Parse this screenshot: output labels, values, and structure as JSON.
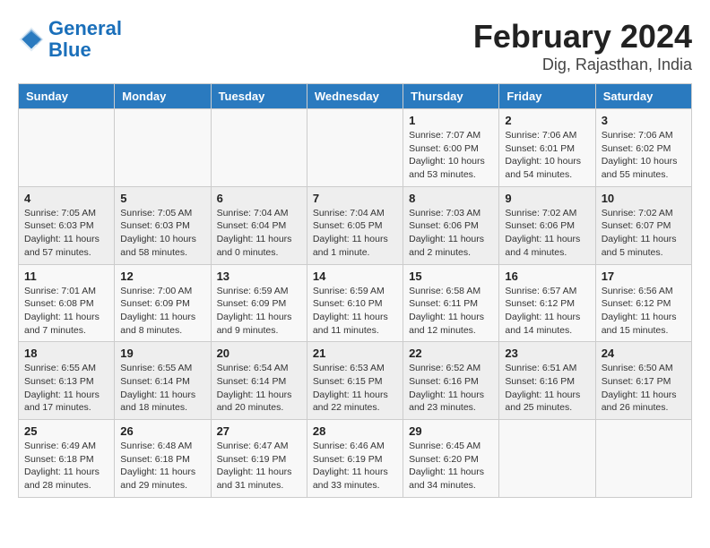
{
  "header": {
    "logo_line1": "General",
    "logo_line2": "Blue",
    "title": "February 2024",
    "subtitle": "Dig, Rajasthan, India"
  },
  "days_of_week": [
    "Sunday",
    "Monday",
    "Tuesday",
    "Wednesday",
    "Thursday",
    "Friday",
    "Saturday"
  ],
  "weeks": [
    [
      {
        "day": "",
        "info": ""
      },
      {
        "day": "",
        "info": ""
      },
      {
        "day": "",
        "info": ""
      },
      {
        "day": "",
        "info": ""
      },
      {
        "day": "1",
        "info": "Sunrise: 7:07 AM\nSunset: 6:00 PM\nDaylight: 10 hours and 53 minutes."
      },
      {
        "day": "2",
        "info": "Sunrise: 7:06 AM\nSunset: 6:01 PM\nDaylight: 10 hours and 54 minutes."
      },
      {
        "day": "3",
        "info": "Sunrise: 7:06 AM\nSunset: 6:02 PM\nDaylight: 10 hours and 55 minutes."
      }
    ],
    [
      {
        "day": "4",
        "info": "Sunrise: 7:05 AM\nSunset: 6:03 PM\nDaylight: 11 hours and 57 minutes."
      },
      {
        "day": "5",
        "info": "Sunrise: 7:05 AM\nSunset: 6:03 PM\nDaylight: 10 hours and 58 minutes."
      },
      {
        "day": "6",
        "info": "Sunrise: 7:04 AM\nSunset: 6:04 PM\nDaylight: 11 hours and 0 minutes."
      },
      {
        "day": "7",
        "info": "Sunrise: 7:04 AM\nSunset: 6:05 PM\nDaylight: 11 hours and 1 minute."
      },
      {
        "day": "8",
        "info": "Sunrise: 7:03 AM\nSunset: 6:06 PM\nDaylight: 11 hours and 2 minutes."
      },
      {
        "day": "9",
        "info": "Sunrise: 7:02 AM\nSunset: 6:06 PM\nDaylight: 11 hours and 4 minutes."
      },
      {
        "day": "10",
        "info": "Sunrise: 7:02 AM\nSunset: 6:07 PM\nDaylight: 11 hours and 5 minutes."
      }
    ],
    [
      {
        "day": "11",
        "info": "Sunrise: 7:01 AM\nSunset: 6:08 PM\nDaylight: 11 hours and 7 minutes."
      },
      {
        "day": "12",
        "info": "Sunrise: 7:00 AM\nSunset: 6:09 PM\nDaylight: 11 hours and 8 minutes."
      },
      {
        "day": "13",
        "info": "Sunrise: 6:59 AM\nSunset: 6:09 PM\nDaylight: 11 hours and 9 minutes."
      },
      {
        "day": "14",
        "info": "Sunrise: 6:59 AM\nSunset: 6:10 PM\nDaylight: 11 hours and 11 minutes."
      },
      {
        "day": "15",
        "info": "Sunrise: 6:58 AM\nSunset: 6:11 PM\nDaylight: 11 hours and 12 minutes."
      },
      {
        "day": "16",
        "info": "Sunrise: 6:57 AM\nSunset: 6:12 PM\nDaylight: 11 hours and 14 minutes."
      },
      {
        "day": "17",
        "info": "Sunrise: 6:56 AM\nSunset: 6:12 PM\nDaylight: 11 hours and 15 minutes."
      }
    ],
    [
      {
        "day": "18",
        "info": "Sunrise: 6:55 AM\nSunset: 6:13 PM\nDaylight: 11 hours and 17 minutes."
      },
      {
        "day": "19",
        "info": "Sunrise: 6:55 AM\nSunset: 6:14 PM\nDaylight: 11 hours and 18 minutes."
      },
      {
        "day": "20",
        "info": "Sunrise: 6:54 AM\nSunset: 6:14 PM\nDaylight: 11 hours and 20 minutes."
      },
      {
        "day": "21",
        "info": "Sunrise: 6:53 AM\nSunset: 6:15 PM\nDaylight: 11 hours and 22 minutes."
      },
      {
        "day": "22",
        "info": "Sunrise: 6:52 AM\nSunset: 6:16 PM\nDaylight: 11 hours and 23 minutes."
      },
      {
        "day": "23",
        "info": "Sunrise: 6:51 AM\nSunset: 6:16 PM\nDaylight: 11 hours and 25 minutes."
      },
      {
        "day": "24",
        "info": "Sunrise: 6:50 AM\nSunset: 6:17 PM\nDaylight: 11 hours and 26 minutes."
      }
    ],
    [
      {
        "day": "25",
        "info": "Sunrise: 6:49 AM\nSunset: 6:18 PM\nDaylight: 11 hours and 28 minutes."
      },
      {
        "day": "26",
        "info": "Sunrise: 6:48 AM\nSunset: 6:18 PM\nDaylight: 11 hours and 29 minutes."
      },
      {
        "day": "27",
        "info": "Sunrise: 6:47 AM\nSunset: 6:19 PM\nDaylight: 11 hours and 31 minutes."
      },
      {
        "day": "28",
        "info": "Sunrise: 6:46 AM\nSunset: 6:19 PM\nDaylight: 11 hours and 33 minutes."
      },
      {
        "day": "29",
        "info": "Sunrise: 6:45 AM\nSunset: 6:20 PM\nDaylight: 11 hours and 34 minutes."
      },
      {
        "day": "",
        "info": ""
      },
      {
        "day": "",
        "info": ""
      }
    ]
  ]
}
